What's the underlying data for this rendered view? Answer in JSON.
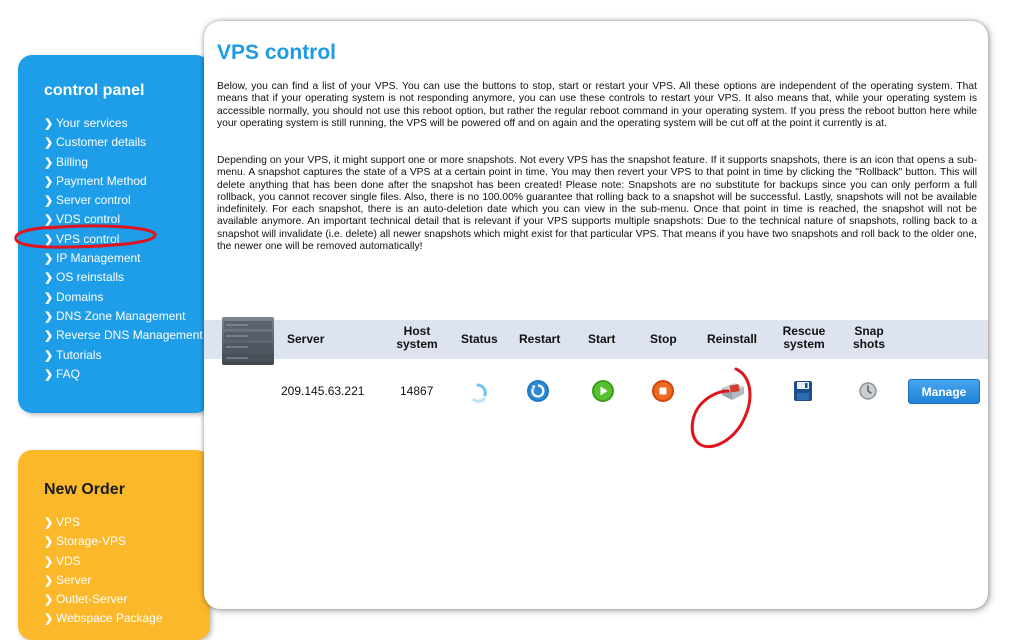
{
  "sidebar": {
    "title": "control panel",
    "items": [
      {
        "label": "Your services"
      },
      {
        "label": "Customer details"
      },
      {
        "label": "Billing"
      },
      {
        "label": "Payment Method"
      },
      {
        "label": "Server control"
      },
      {
        "label": "VDS control"
      },
      {
        "label": "VPS control"
      },
      {
        "label": "IP Management"
      },
      {
        "label": "OS reinstalls"
      },
      {
        "label": "Domains"
      },
      {
        "label": "DNS Zone Management"
      },
      {
        "label": "Reverse DNS Management"
      },
      {
        "label": "Tutorials"
      },
      {
        "label": "FAQ"
      }
    ]
  },
  "new_order": {
    "title": "New Order",
    "items": [
      {
        "label": "VPS"
      },
      {
        "label": "Storage-VPS"
      },
      {
        "label": "VDS"
      },
      {
        "label": "Server"
      },
      {
        "label": "Outlet-Server"
      },
      {
        "label": "Webspace Package"
      }
    ]
  },
  "main": {
    "title": "VPS control",
    "paragraph1": "Below, you can find a list of your VPS. You can use the buttons to stop, start or restart your VPS. All these options are independent of the operating system. That means that if your operating system is not responding anymore, you can use these controls to restart your VPS. It also means that, while your operating system is accessible normally, you should not use this reboot option, but rather the regular reboot command in your operating system. If you press the reboot button here while your operating system is still running, the VPS will be powered off and on again and the operating system will be cut off at the point it currently is at.",
    "paragraph2": "Depending on your VPS, it might support one or more snapshots. Not every VPS has the snapshot feature. If it supports snapshots, there is an icon that opens a sub-menu. A snapshot captures the state of a VPS at a certain point in time. You may then revert your VPS to that point in time by clicking the \"Rollback\" button. This will delete anything that has been done after the snapshot has been created! Please note: Snapshots are no substitute for backups since you can only perform a full rollback, you cannot recover single files. Also, there is no 100.00% guarantee that rolling back to a snapshot will be successful. Lastly, snapshots will not be available indefinitely. For each snapshot, there is an auto-deletion date which you can view in the sub-menu. Once that point in time is reached, the snapshot will not be available anymore. An important technical detail that is relevant if your VPS supports multiple snapshots: Due to the technical nature of snapshots, rolling back to a snapshot will invalidate (i.e. delete) all newer snapshots which might exist for that particular VPS. That means if you have two snapshots and roll back to the older one, the newer one will be removed automatically!"
  },
  "table": {
    "headers": {
      "server": "Server",
      "host_line1": "Host",
      "host_line2": "system",
      "status": "Status",
      "restart": "Restart",
      "start": "Start",
      "stop": "Stop",
      "reinstall": "Reinstall",
      "rescue_line1": "Rescue",
      "rescue_line2": "system",
      "snap_line1": "Snap",
      "snap_line2": "shots"
    },
    "rows": [
      {
        "server": "209.145.63.221",
        "host_system": "14867",
        "manage_label": "Manage"
      }
    ]
  },
  "colors": {
    "sidebar_blue": "#1e9ee8",
    "new_order_orange": "#fbb82a",
    "title_blue": "#1d9be3",
    "annotation_red": "#e0141c"
  }
}
